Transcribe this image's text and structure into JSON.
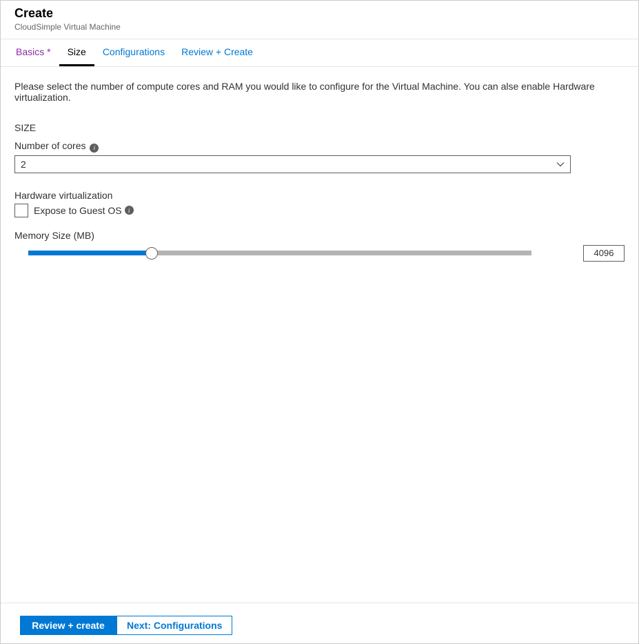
{
  "header": {
    "title": "Create",
    "subtitle": "CloudSimple Virtual Machine"
  },
  "tabs": {
    "items": [
      {
        "label": "Basics *",
        "state": "visited"
      },
      {
        "label": "Size",
        "state": "active"
      },
      {
        "label": "Configurations",
        "state": "normal"
      },
      {
        "label": "Review + Create",
        "state": "normal"
      }
    ]
  },
  "content": {
    "description": "Please select the number of compute cores and RAM you would like to configure for the Virtual Machine. You can alse enable Hardware virtualization.",
    "section_title": "SIZE",
    "cores": {
      "label": "Number of cores",
      "value": "2"
    },
    "hardware": {
      "label": "Hardware virtualization",
      "checkbox_label": "Expose to Guest OS"
    },
    "memory": {
      "label": "Memory Size (MB)",
      "value": "4096"
    }
  },
  "footer": {
    "primary": "Review + create",
    "secondary": "Next: Configurations"
  }
}
